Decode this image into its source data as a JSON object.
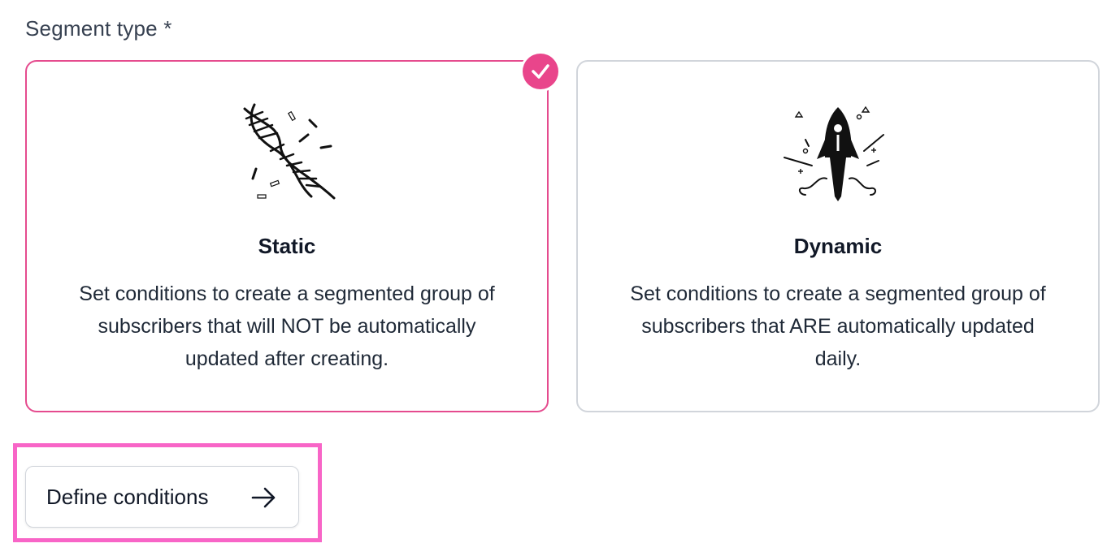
{
  "segment_type": {
    "label": "Segment type *",
    "options": [
      {
        "title": "Static",
        "description": "Set conditions to create a segmented group of subscribers that will NOT be automatically updated after creating.",
        "icon": "dna-icon",
        "selected": true
      },
      {
        "title": "Dynamic",
        "description": "Set conditions to create a segmented group of subscribers that ARE automatically updated daily.",
        "icon": "rocket-icon",
        "selected": false
      }
    ]
  },
  "actions": {
    "define_conditions_label": "Define conditions",
    "define_conditions_icon": "arrow-right-icon"
  },
  "colors": {
    "accent": "#e9458b",
    "highlight": "#f865c7",
    "border": "#d1d5db"
  }
}
